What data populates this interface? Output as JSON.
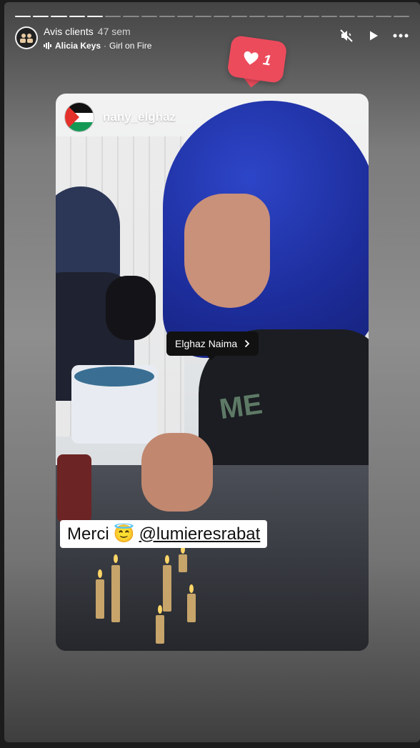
{
  "progress": {
    "total": 22,
    "done": 5
  },
  "header": {
    "title": "Avis clients",
    "time": "47 sem",
    "music_artist": "Alicia Keys",
    "music_separator": "·",
    "music_track": "Girl on Fire"
  },
  "controls": {
    "icons": [
      "speaker-muted-icon",
      "play-icon",
      "more-icon"
    ]
  },
  "like_sticker": {
    "count": "1",
    "color": "#ec4b5c"
  },
  "post": {
    "username": "nany_elghaz",
    "tag_label": "Elghaz Naima",
    "caption_prefix": "Merci",
    "caption_emoji": "😇",
    "caption_mention": "@lumieresrabat"
  }
}
